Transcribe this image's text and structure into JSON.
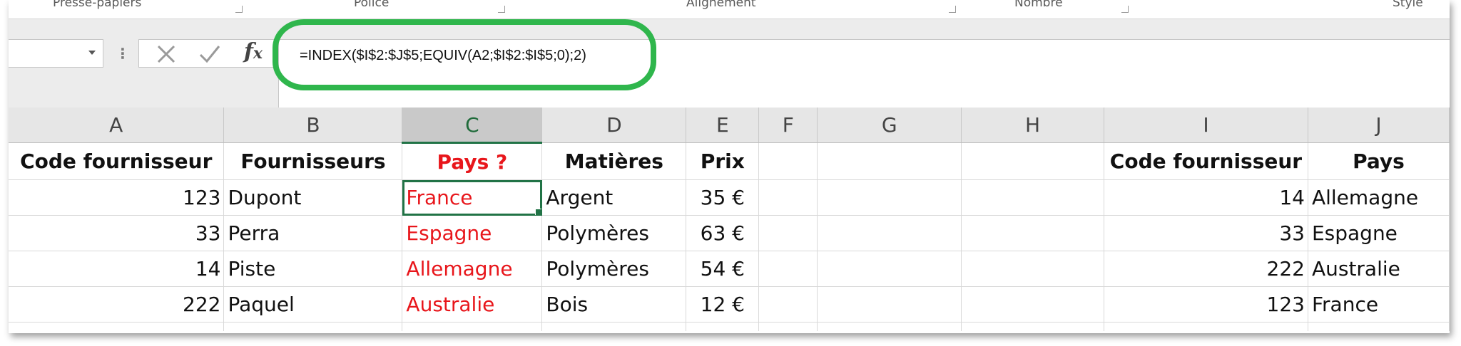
{
  "ribbon": {
    "groups": [
      "Presse-papiers",
      "Police",
      "Alignement",
      "Nombre",
      "Style"
    ]
  },
  "formula_bar": {
    "name_box": "",
    "cancel_icon": "cancel-x-icon",
    "enter_icon": "checkmark-icon",
    "function_icon": "fx",
    "formula": "=INDEX($I$2:$J$5;EQUIV(A2;$I$2:$I$5;0);2)",
    "highlight_color": "#2fb64c"
  },
  "columns": [
    "A",
    "B",
    "C",
    "D",
    "E",
    "F",
    "G",
    "H",
    "I",
    "J"
  ],
  "selected_column": "C",
  "header_row": {
    "A": "Code fournisseur",
    "B": "Fournisseurs",
    "C": "Pays ?",
    "D": "Matières",
    "E": "Prix",
    "I": "Code fournisseur",
    "J": "Pays"
  },
  "rows": [
    {
      "A": "123",
      "B": "Dupont",
      "C": "France",
      "D": "Argent",
      "E": "35 €",
      "I": "14",
      "J": "Allemagne"
    },
    {
      "A": "33",
      "B": "Perra",
      "C": "Espagne",
      "D": "Polymères",
      "E": "63 €",
      "I": "33",
      "J": "Espagne"
    },
    {
      "A": "14",
      "B": "Piste",
      "C": "Allemagne",
      "D": "Polymères",
      "E": "54 €",
      "I": "222",
      "J": "Australie"
    },
    {
      "A": "222",
      "B": "Paquel",
      "C": "Australie",
      "D": "Bois",
      "E": "12 €",
      "I": "123",
      "J": "France"
    }
  ],
  "colors": {
    "accent_red": "#e8161b",
    "selection_green": "#217346"
  }
}
